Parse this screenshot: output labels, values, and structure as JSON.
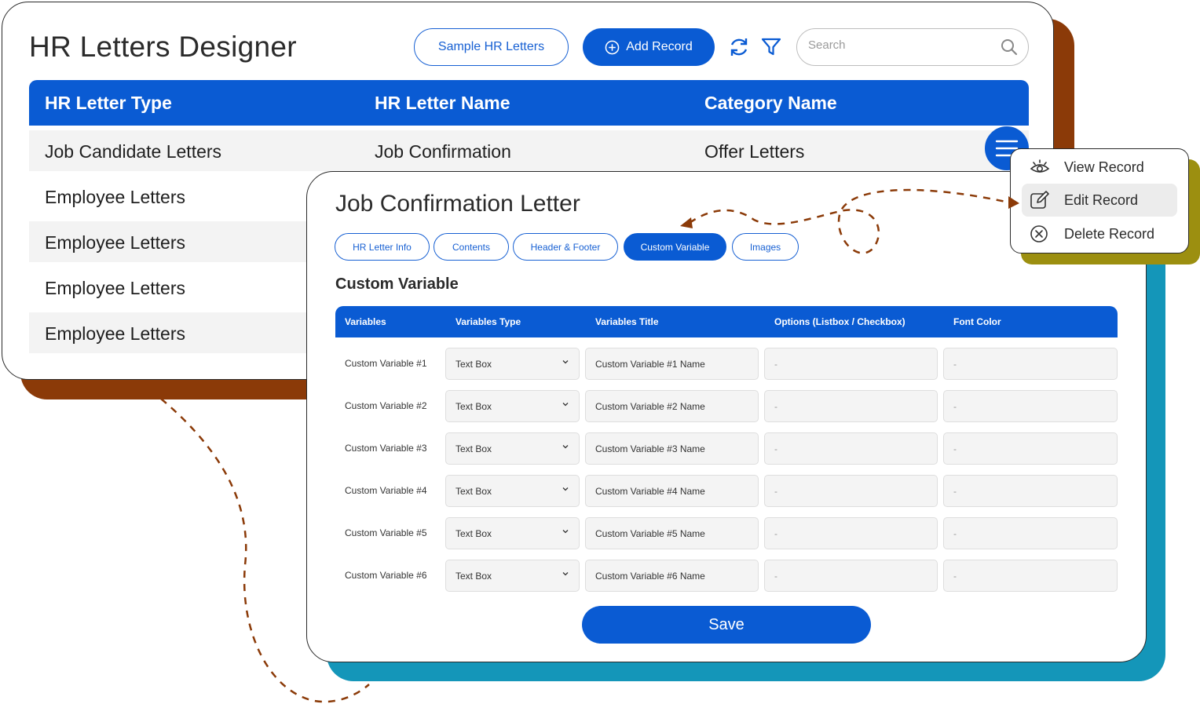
{
  "app": {
    "title": "HR Letters Designer",
    "sample_button": "Sample HR Letters",
    "add_button": "Add Record",
    "search_placeholder": "Search"
  },
  "main_table": {
    "headers": [
      "HR Letter Type",
      "HR Letter Name",
      "Category Name"
    ],
    "rows": [
      [
        "Job Candidate Letters",
        "Job Confirmation",
        "Offer Letters"
      ],
      [
        "Employee Letters",
        "",
        ""
      ],
      [
        "Employee Letters",
        "",
        ""
      ],
      [
        "Employee Letters",
        "",
        ""
      ],
      [
        "Employee Letters",
        "",
        ""
      ]
    ]
  },
  "context_menu": {
    "items": [
      "View Record",
      "Edit Record",
      "Delete Record"
    ],
    "active": "Edit Record"
  },
  "dialog": {
    "title": "Job Confirmation Letter",
    "tabs": [
      "HR Letter Info",
      "Contents",
      "Header & Footer",
      "Custom Variable",
      "Images"
    ],
    "active_tab": "Custom Variable",
    "section_title": "Custom Variable",
    "columns": [
      "Variables",
      "Variables Type",
      "Variables Title",
      "Options (Listbox / Checkbox)",
      "Font Color"
    ],
    "rows": [
      {
        "variable": "Custom Variable #1",
        "type": "Text Box",
        "title": "Custom Variable #1 Name",
        "options": "-",
        "font_color": "-"
      },
      {
        "variable": "Custom Variable #2",
        "type": "Text Box",
        "title": "Custom Variable #2 Name",
        "options": "-",
        "font_color": "-"
      },
      {
        "variable": "Custom Variable #3",
        "type": "Text Box",
        "title": "Custom Variable #3 Name",
        "options": "-",
        "font_color": "-"
      },
      {
        "variable": "Custom Variable #4",
        "type": "Text Box",
        "title": "Custom Variable #4 Name",
        "options": "-",
        "font_color": "-"
      },
      {
        "variable": "Custom Variable #5",
        "type": "Text Box",
        "title": "Custom Variable #5 Name",
        "options": "-",
        "font_color": "-"
      },
      {
        "variable": "Custom Variable #6",
        "type": "Text Box",
        "title": "Custom Variable #6 Name",
        "options": "-",
        "font_color": "-"
      }
    ],
    "save_button": "Save"
  },
  "icons": {
    "refresh": "refresh-icon",
    "filter": "filter-icon",
    "search": "search-icon",
    "menu": "hamburger-menu-icon",
    "view": "eye-icon",
    "edit": "edit-icon",
    "delete": "delete-circle-x-icon",
    "add": "plus-circle-icon",
    "dropdown": "chevron-down-icon"
  },
  "colors": {
    "primary": "#0a5bd3",
    "back_shadow": "#8b3a08",
    "front_shadow": "#1496b9",
    "menu_shadow": "#9c8f10",
    "dashed_arrow": "#8b3a08"
  }
}
